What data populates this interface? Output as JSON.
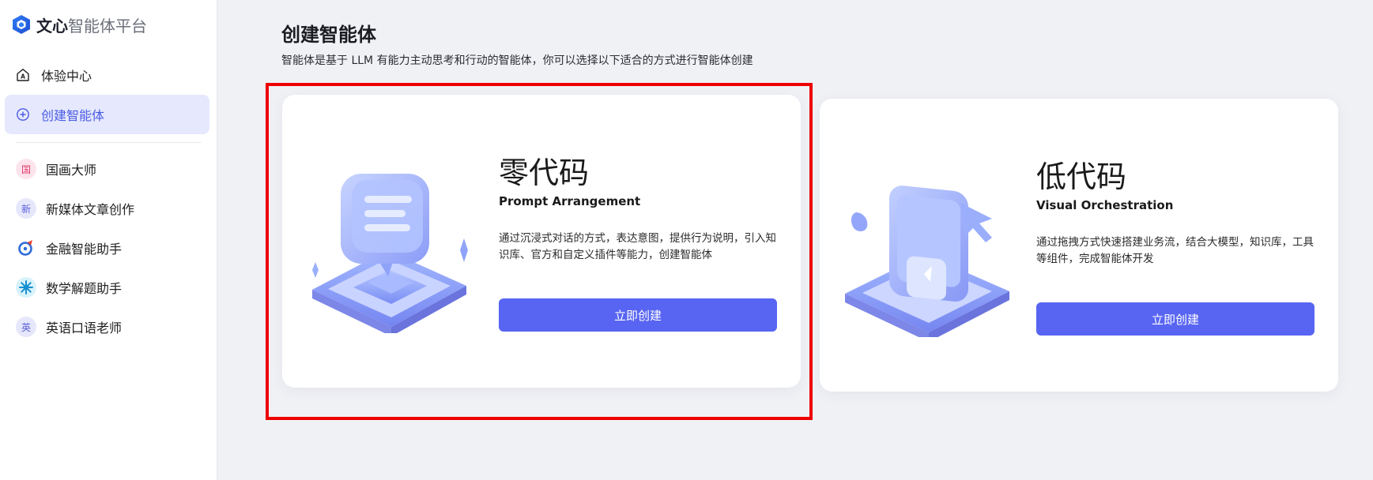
{
  "brand": {
    "name_bold": "文心",
    "name_rest": "智能体平台"
  },
  "nav": [
    {
      "label": "体验中心",
      "icon": "home-a-icon"
    },
    {
      "label": "创建智能体",
      "icon": "plus-circle-icon",
      "active": true
    }
  ],
  "agents": [
    {
      "label": "国画大师",
      "avatar_text": "国",
      "color": "#e23c6b",
      "bg": "#fde4ec"
    },
    {
      "label": "新媒体文章创作",
      "avatar_text": "新",
      "color": "#5b5fd8",
      "bg": "#e6e7fb"
    },
    {
      "label": "金融智能助手",
      "avatar_text": "",
      "icon": "finance-logo-icon",
      "color": "#2f6bd8",
      "bg": "#ffffff"
    },
    {
      "label": "数学解题助手",
      "avatar_text": "",
      "icon": "math-burst-icon",
      "color": "#1aa6e0",
      "bg": "#d9f2fc"
    },
    {
      "label": "英语口语老师",
      "avatar_text": "英",
      "color": "#5b5fd8",
      "bg": "#e6e7fb"
    }
  ],
  "main": {
    "title": "创建智能体",
    "subtitle": "智能体是基于 LLM 有能力主动思考和行动的智能体，你可以选择以下适合的方式进行智能体创建"
  },
  "cards": [
    {
      "title": "零代码",
      "subtitle": "Prompt Arrangement",
      "desc": "通过沉浸式对话的方式，表达意图，提供行为说明，引入知识库、官方和自定义插件等能力，创建智能体",
      "button": "立即创建",
      "illustration": "chat-bubble-illustration"
    },
    {
      "title": "低代码",
      "subtitle": "Visual Orchestration",
      "desc": "通过拖拽方式快速搭建业务流，结合大模型，知识库，工具等组件，完成智能体开发",
      "button": "立即创建",
      "illustration": "cursor-screen-illustration"
    }
  ],
  "colors": {
    "accent": "#5865f2",
    "active_bg": "#e6e9fd",
    "highlight": "#ee0000"
  }
}
